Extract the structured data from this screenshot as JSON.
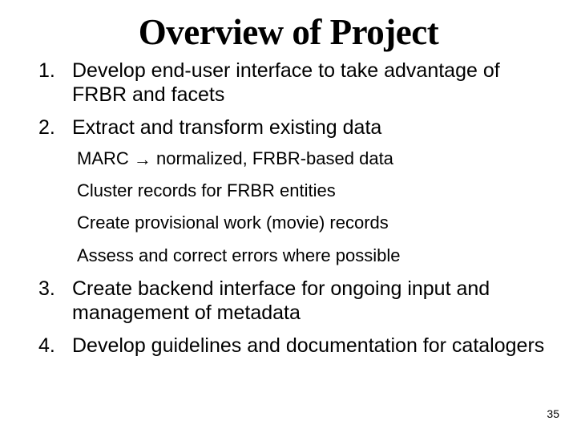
{
  "title": "Overview of Project",
  "items": [
    {
      "text": "Develop end-user interface to take advantage of FRBR and facets"
    },
    {
      "text": "Extract and transform existing data",
      "sub": [
        {
          "pre": "MARC ",
          "arrow": "→",
          "post": " normalized, FRBR-based data"
        },
        {
          "text": "Cluster records for FRBR entities"
        },
        {
          "text": "Create provisional work (movie) records"
        },
        {
          "text": "Assess and correct errors where possible"
        }
      ]
    },
    {
      "text": "Create backend interface for ongoing input and management of metadata"
    },
    {
      "text": "Develop guidelines and documentation for catalogers"
    }
  ],
  "page_number": "35"
}
